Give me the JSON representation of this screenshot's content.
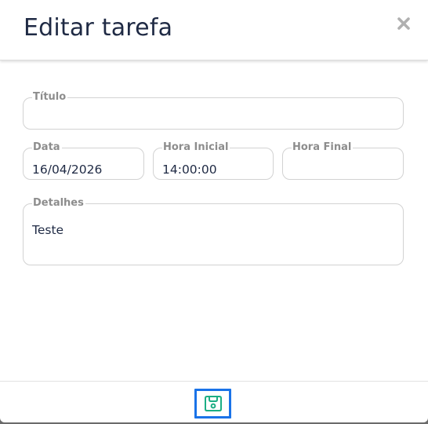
{
  "modal": {
    "title": "Editar tarefa"
  },
  "form": {
    "titulo": {
      "label": "Título",
      "value": ""
    },
    "data": {
      "label": "Data",
      "value": "16/04/2026"
    },
    "hora_inicial": {
      "label": "Hora Inicial",
      "value": "14:00:00"
    },
    "hora_final": {
      "label": "Hora Final",
      "value": ""
    },
    "detalhes": {
      "label": "Detalhes",
      "value": "Teste"
    }
  },
  "icons": {
    "close": "close-icon",
    "save": "save-icon"
  },
  "colors": {
    "title_text": "#1f2a44",
    "label_text": "#8d8d8d",
    "field_border": "#d2d2d2",
    "save_icon": "#1cae84",
    "focus_outline": "#1a73e8",
    "close_icon": "#b0b0b0"
  }
}
